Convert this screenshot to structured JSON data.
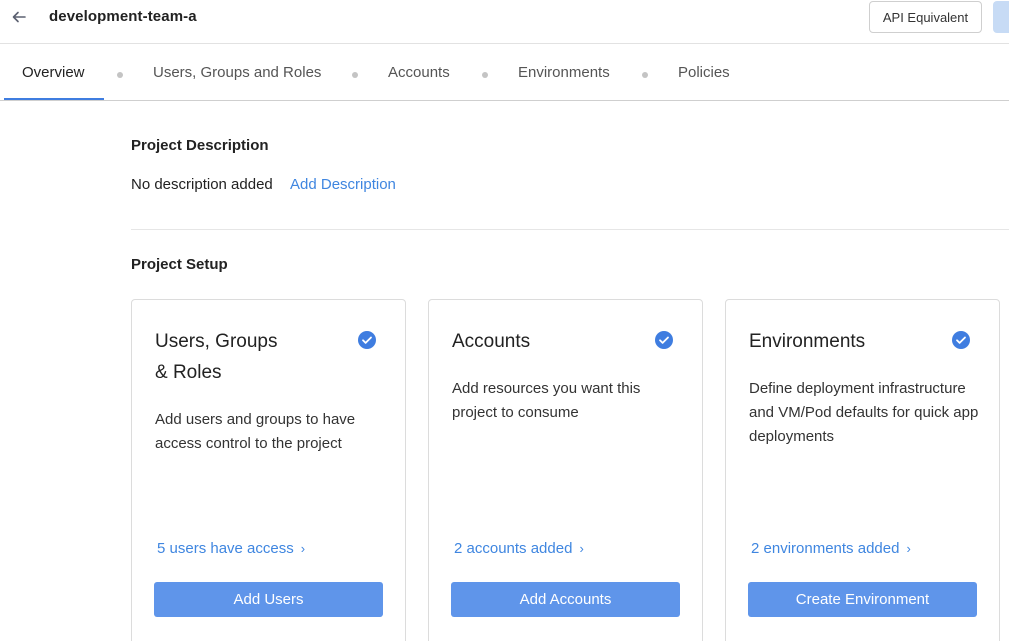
{
  "header": {
    "title": "development-team-a",
    "api_button_label": "API Equivalent"
  },
  "tabs": [
    {
      "label": "Overview",
      "active": true
    },
    {
      "label": "Users, Groups and Roles",
      "active": false
    },
    {
      "label": "Accounts",
      "active": false
    },
    {
      "label": "Environments",
      "active": false
    },
    {
      "label": "Policies",
      "active": false
    }
  ],
  "description": {
    "title": "Project Description",
    "text": "No description added",
    "link": "Add Description"
  },
  "setup": {
    "title": "Project Setup",
    "cards": [
      {
        "title_line1": "Users, Groups",
        "title_line2": "& Roles",
        "description": "Add users and groups to have access control to the project",
        "status_link": "5 users have access",
        "button": "Add Users",
        "completed": true,
        "icon": "check-circle-icon"
      },
      {
        "title_line1": "Accounts",
        "title_line2": "",
        "description": "Add resources you want this project to consume",
        "status_link": "2 accounts added",
        "button": "Add Accounts",
        "completed": true,
        "icon": "check-circle-icon"
      },
      {
        "title_line1": "Environments",
        "title_line2": "",
        "description": "Define deployment infrastructure and VM/Pod defaults for quick app deployments",
        "status_link": "2 environments added",
        "button": "Create Environment",
        "completed": true,
        "icon": "check-circle-icon"
      }
    ]
  },
  "colors": {
    "accent": "#3f86e0",
    "primary_button": "#5f95ea",
    "check": "#3f7de0"
  }
}
